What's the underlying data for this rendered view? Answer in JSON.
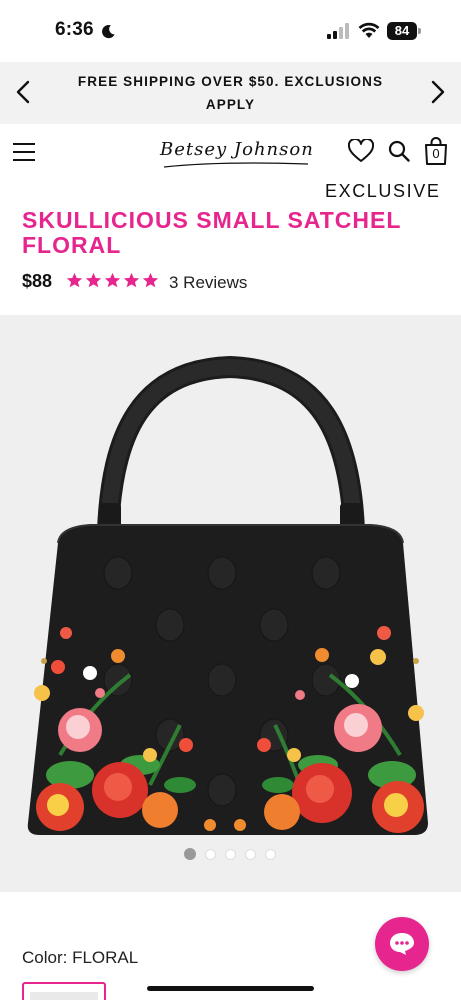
{
  "status_bar": {
    "time": "6:36",
    "battery": "84"
  },
  "promo": {
    "text": "FREE SHIPPING OVER $50. EXCLUSIONS APPLY"
  },
  "header": {
    "logo_text": "Betsey Johnson",
    "bag_count": "0"
  },
  "product": {
    "badge": "EXCLUSIVE",
    "title": "SKULLICIOUS SMALL SATCHEL FLORAL",
    "price": "$88",
    "rating": 5,
    "reviews": "3 Reviews",
    "color_label": "Color: FLORAL"
  },
  "gallery": {
    "slide_count": 5,
    "active_slide": 1
  },
  "colors": {
    "accent": "#e6268e",
    "banner_bg": "#f2f2f2",
    "gallery_bg": "#efefef"
  },
  "icons": [
    "moon-icon",
    "signal-icon",
    "wifi-icon",
    "battery-icon",
    "chevron-left-icon",
    "chevron-right-icon",
    "menu-icon",
    "heart-icon",
    "search-icon",
    "shopping-bag-icon",
    "star-icon",
    "chat-icon"
  ]
}
